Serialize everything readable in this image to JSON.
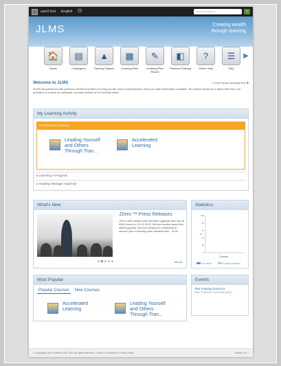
{
  "topbar": {
    "user": "user2 test",
    "language": "English",
    "search_placeholder": "search keyword",
    "search_go": "Go"
  },
  "header": {
    "logo": "JLMS",
    "tagline_1": "Creating wealth",
    "tagline_2": "through learning"
  },
  "nav": [
    {
      "label": "Home",
      "icon": "home-icon",
      "glyph": "🏠"
    },
    {
      "label": "Catalogues",
      "icon": "catalogue-icon",
      "glyph": "▤"
    },
    {
      "label": "Training Classes",
      "icon": "training-classes-icon",
      "glyph": "▲"
    },
    {
      "label": "Learning Plan",
      "icon": "learning-plan-icon",
      "glyph": "▦"
    },
    {
      "label": "Learning Plan Report",
      "icon": "report-icon",
      "glyph": "✎"
    },
    {
      "label": "Previous Training",
      "icon": "previous-training-icon",
      "glyph": "◧"
    },
    {
      "label": "Online Help",
      "icon": "help-icon",
      "glyph": "?"
    },
    {
      "label": "FAQ",
      "icon": "faq-icon",
      "glyph": "☰"
    }
  ],
  "welcome": {
    "title": "Welcome to JLMS",
    "dont_show": "Don't show message box",
    "text": "JLMS has partnered with premium content providers to bring you the most comprehensive and up-to-date information available. All content comes as a direct feed from our providers to ensure an unbiased, accurate picture of the medical world."
  },
  "learning_activity": {
    "title": "My Learning Activity",
    "scheduled_label": "▾ Scheduled Learning",
    "courses": [
      "Leading Yourself and Others Through Tran...",
      "Accelerated Learning"
    ],
    "in_progress": "▸ Learning in Progress",
    "awaiting": "▸ Awaiting Manager Approval"
  },
  "whats_new": {
    "title": "What's New",
    "headline": "JZero ™ Press Releases",
    "body": "JZero LMS newest web interface upgrade went live at 0500 hours on 01.01.2012. We are excited about this latest upgrade and look forward to continuing to service your e-learning and business lear...",
    "more": "more",
    "see_all": "see all"
  },
  "statistics": {
    "title": "Statistics",
    "axis": "Courses",
    "legend_1": "You results",
    "legend_2": "Company average",
    "y_ticks": [
      "100",
      "80",
      "60",
      "40",
      "20",
      "0"
    ]
  },
  "chart_data": {
    "type": "bar",
    "title": "",
    "xlabel": "Courses",
    "ylabel": "%",
    "ylim": [
      0,
      100
    ],
    "categories": [],
    "series": [
      {
        "name": "You results",
        "values": []
      },
      {
        "name": "Company average",
        "values": []
      }
    ],
    "legend": "bottom",
    "grid": false
  },
  "events": {
    "title": "Events",
    "event_title": "Test Training Event 01",
    "event_date": "Date: 7/10/2013 7:00:00 AM (GMT)"
  },
  "most_popular": {
    "title": "Most Popular",
    "tabs": [
      "Popular Courses",
      "New Courses"
    ],
    "courses": [
      "Accelerated Learning",
      "Leading Yourself and Others Through Tran..."
    ]
  },
  "footer": {
    "copyright": "© Copyright JZero Solutions Ltd. 2012 All rights reserved. | Terms & Conditions | Privacy Policy",
    "version": "Version 3.0.7"
  }
}
